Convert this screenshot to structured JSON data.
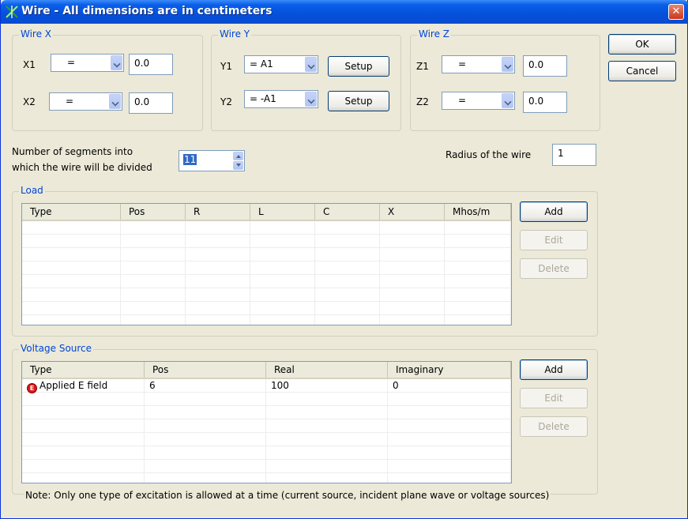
{
  "window": {
    "title": "Wire - All dimensions are in centimeters",
    "close_glyph": "✕"
  },
  "wire_x": {
    "legend": "Wire X",
    "x1": {
      "label": "X1",
      "combo": "=",
      "value": "0.0"
    },
    "x2": {
      "label": "X2",
      "combo": "=",
      "value": "0.0"
    }
  },
  "wire_y": {
    "legend": "Wire Y",
    "y1": {
      "label": "Y1",
      "combo": "= A1",
      "setup": "Setup"
    },
    "y2": {
      "label": "Y2",
      "combo": "= -A1",
      "setup": "Setup"
    }
  },
  "wire_z": {
    "legend": "Wire Z",
    "z1": {
      "label": "Z1",
      "combo": "=",
      "value": "0.0"
    },
    "z2": {
      "label": "Z2",
      "combo": "=",
      "value": "0.0"
    }
  },
  "buttons": {
    "ok": "OK",
    "cancel": "Cancel"
  },
  "segments": {
    "label_line1": "Number of segments into",
    "label_line2": "which the wire will be divided",
    "value": "11"
  },
  "radius": {
    "label": "Radius of the wire",
    "value": "1"
  },
  "load": {
    "legend": "Load",
    "columns": [
      "Type",
      "Pos",
      "R",
      "L",
      "C",
      "X",
      "Mhos/m"
    ],
    "rows": [],
    "add": "Add",
    "edit": "Edit",
    "delete": "Delete"
  },
  "voltage_source": {
    "legend": "Voltage Source",
    "columns": [
      "Type",
      "Pos",
      "Real",
      "Imaginary"
    ],
    "rows": [
      {
        "type": "Applied E field",
        "pos": "6",
        "real": "100",
        "imag": "0",
        "icon": "E"
      }
    ],
    "add": "Add",
    "edit": "Edit",
    "delete": "Delete"
  },
  "note": "Note: Only one type of excitation is allowed at a time (current source, incident plane wave or voltage sources)"
}
